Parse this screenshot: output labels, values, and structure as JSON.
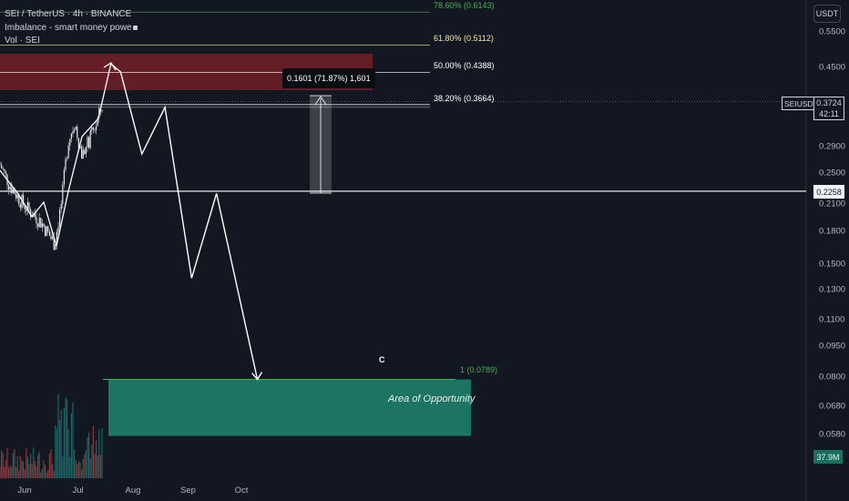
{
  "legend": {
    "symbol_line": "SEI / TetherUS · 4h · BINANCE",
    "indicator_imbalance": "Imbalance - smart money powe",
    "indicator_vol": "Vol · SEI"
  },
  "currency": "USDT",
  "price_axis": {
    "labels": [
      {
        "price": 0.55,
        "text": "0.5500"
      },
      {
        "price": 0.45,
        "text": "0.4500"
      },
      {
        "price": 0.29,
        "text": "0.2900"
      },
      {
        "price": 0.25,
        "text": "0.2500"
      },
      {
        "price": 0.21,
        "text": "0.2100"
      },
      {
        "price": 0.18,
        "text": "0.1800"
      },
      {
        "price": 0.15,
        "text": "0.1500"
      },
      {
        "price": 0.13,
        "text": "0.1300"
      },
      {
        "price": 0.11,
        "text": "0.1100"
      },
      {
        "price": 0.095,
        "text": "0.0950"
      },
      {
        "price": 0.08,
        "text": "0.0800"
      },
      {
        "price": 0.068,
        "text": "0.0680"
      },
      {
        "price": 0.058,
        "text": "0.0580"
      }
    ]
  },
  "time_axis": {
    "labels": [
      "Jun",
      "Jul",
      "Aug",
      "Sep",
      "Oct"
    ]
  },
  "fib_levels": [
    {
      "price": 0.6143,
      "text": "78.60% (0.6143)",
      "color": "#4caf50"
    },
    {
      "price": 0.5112,
      "text": "61.80% (0.5112)",
      "color": "#f5e79e"
    },
    {
      "price": 0.4388,
      "text": "50.00% (0.4388)",
      "color": "#ffffff"
    },
    {
      "price": 0.3664,
      "text": "38.20% (0.3664)",
      "color": "#ffffff"
    }
  ],
  "target_level": {
    "price": 0.0789,
    "text": "1 (0.0789)",
    "color": "#4caf50"
  },
  "current_price": {
    "symbol": "SEIUSDT",
    "price": "0.3724",
    "countdown": "42:11"
  },
  "marked_price": "0.2258",
  "volume_value": "37.9M",
  "measure_label": "0.1601 (71.87%) 1,601",
  "wave_label": "C",
  "opportunity_label": "Area of Opportunity",
  "colors": {
    "background": "#131722",
    "imbalance_zone": "#6b1e26",
    "opportunity_zone": "#1b7a66",
    "bull": "#26a69a",
    "bear": "#ef5350",
    "projection": "#ffffff"
  },
  "projection_path": [
    {
      "t": "2024-07-19",
      "price": 0.462
    },
    {
      "t": "2024-07-25",
      "price": 0.44
    },
    {
      "t": "2024-08-06",
      "price": 0.278
    },
    {
      "t": "2024-08-19",
      "price": 0.361
    },
    {
      "t": "2024-09-03",
      "price": 0.139
    },
    {
      "t": "2024-09-17",
      "price": 0.223
    },
    {
      "t": "2024-10-10",
      "price": 0.0789
    }
  ]
}
